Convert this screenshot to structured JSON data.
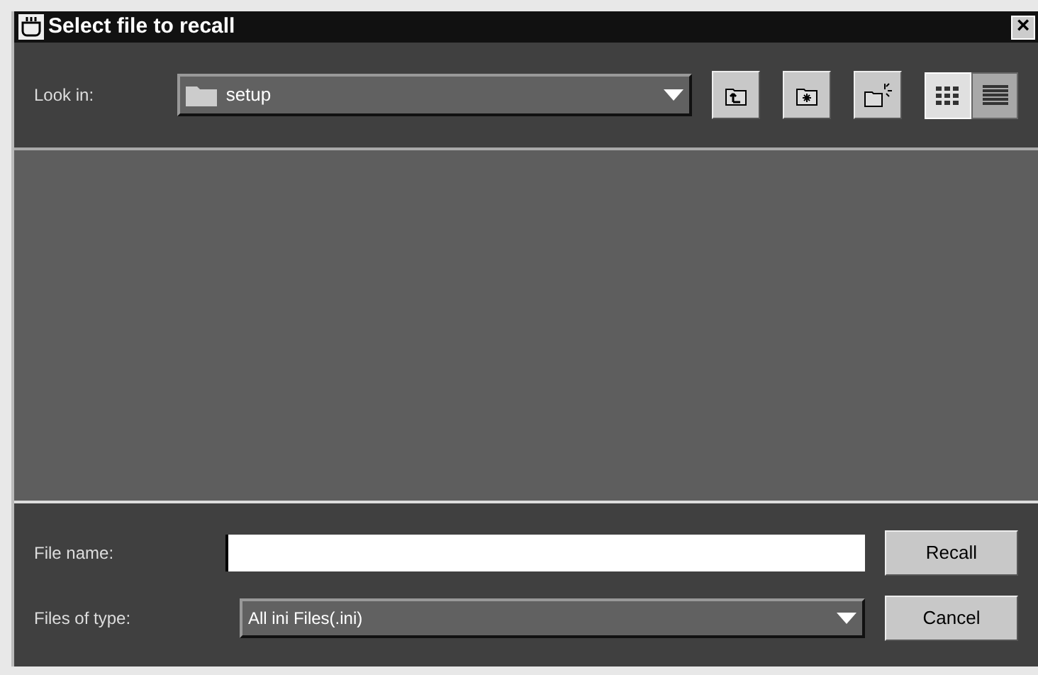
{
  "window": {
    "title": "Select file to recall",
    "close": "×"
  },
  "look_in": {
    "label": "Look in:",
    "value": "setup"
  },
  "toolbar": [
    {
      "kind": "up"
    },
    {
      "kind": "home"
    },
    {
      "kind": "new-folder"
    },
    {
      "kind": "list",
      "selected": false
    },
    {
      "kind": "details",
      "selected": true
    }
  ],
  "file_name": {
    "label": "File name:"
  },
  "file_type": {
    "label": "Files of type:",
    "value": "All ini Files(.ini)"
  },
  "buttons": [
    {
      "label": "Recall"
    },
    {
      "label": "Cancel"
    }
  ]
}
